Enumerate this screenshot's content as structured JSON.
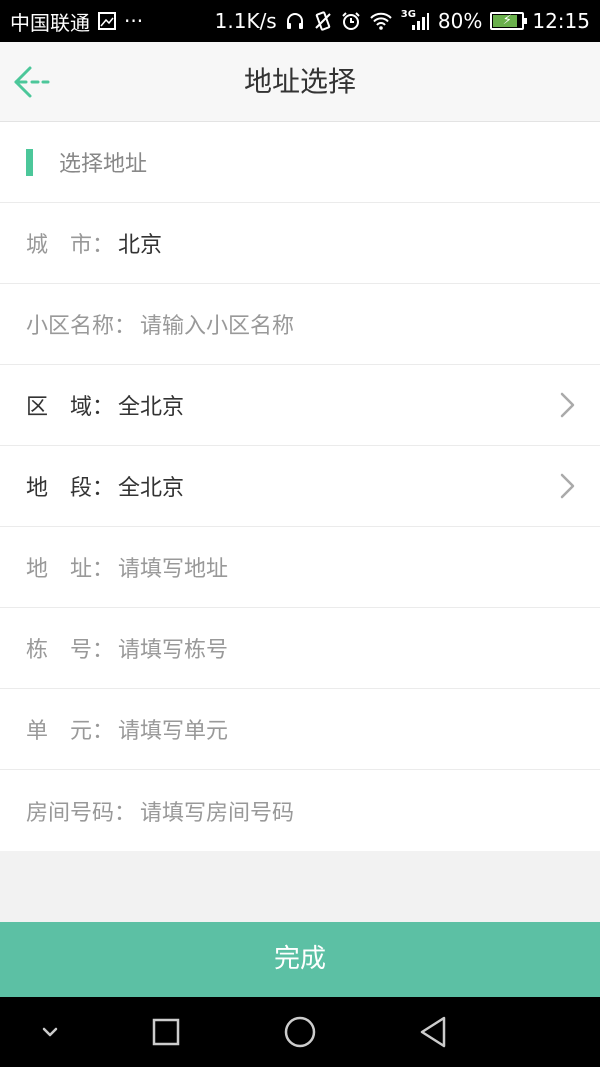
{
  "status_bar": {
    "carrier": "中国联通",
    "more": "···",
    "speed": "1.1K/s",
    "network_label": "3G",
    "battery_percent": "80%",
    "battery_level": 0.8,
    "time": "12:15"
  },
  "header": {
    "title": "地址选择"
  },
  "form": {
    "section_title": "选择地址",
    "city": {
      "label": "城　市：",
      "value": "北京"
    },
    "community": {
      "label": "小区名称：",
      "placeholder": "请输入小区名称"
    },
    "district": {
      "label": "区　域：",
      "value": "全北京"
    },
    "area": {
      "label": "地　段：",
      "value": "全北京"
    },
    "address": {
      "label": "地　址：",
      "placeholder": "请填写地址"
    },
    "building": {
      "label": "栋　号：",
      "placeholder": "请填写栋号"
    },
    "unit": {
      "label": "单　元：",
      "placeholder": "请填写单元"
    },
    "room": {
      "label": "房间号码：",
      "placeholder": "请填写房间号码"
    }
  },
  "done_button": {
    "label": "完成"
  },
  "colors": {
    "accent": "#4cc79a",
    "button": "#5cc0a4"
  }
}
